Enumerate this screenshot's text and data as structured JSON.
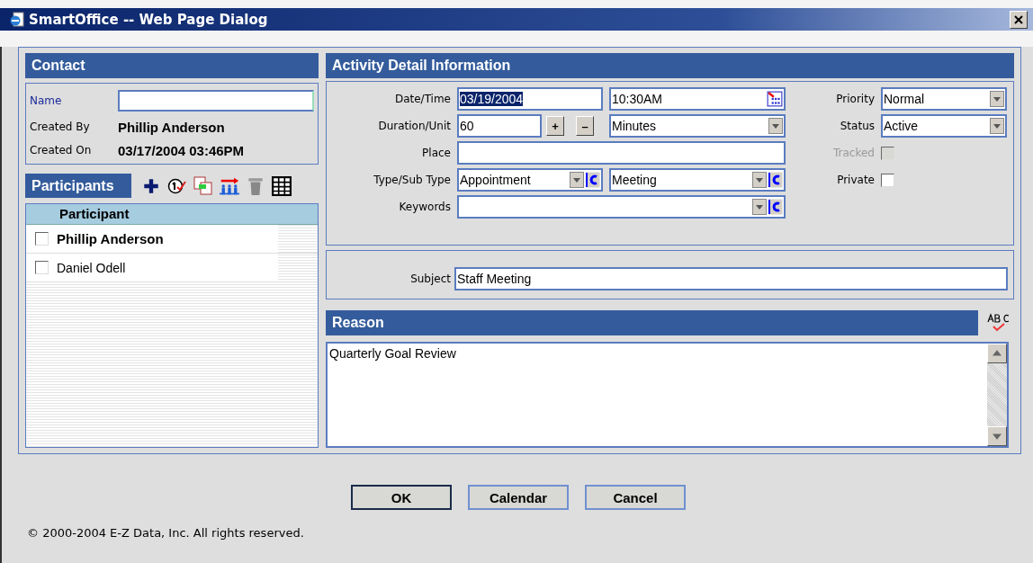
{
  "window": {
    "title": "SmartOffice -- Web Page Dialog"
  },
  "contact": {
    "header": "Contact",
    "fields": [
      {
        "label": "Name",
        "kind": "input",
        "link": true
      },
      {
        "label": "Created By",
        "kind": "value",
        "value": "Phillip Anderson",
        "link": false
      },
      {
        "label": "Created On",
        "kind": "value",
        "value": "03/17/2004 03:46PM",
        "link": false
      }
    ]
  },
  "participants": {
    "header": "Participants",
    "column": "Participant",
    "rows": [
      {
        "name": "Phillip Anderson",
        "checked": false,
        "primary": true
      },
      {
        "name": "Daniel Odell",
        "checked": false,
        "primary": false
      }
    ]
  },
  "activity": {
    "header": "Activity Detail Information",
    "rows": [
      {
        "label": "Date/Time",
        "controls": [
          {
            "kind": "text",
            "value": "03/19/2004",
            "highlighted": true
          },
          {
            "kind": "time",
            "value": "10:30AM"
          }
        ]
      },
      {
        "label": "Duration/Unit",
        "controls": [
          {
            "kind": "spinner",
            "value": "60",
            "buttons": [
              "+",
              "–"
            ]
          },
          {
            "kind": "select",
            "value": "Minutes"
          }
        ]
      },
      {
        "label": "Place",
        "controls": [
          {
            "kind": "wide"
          }
        ]
      },
      {
        "label": "Type/Sub Type",
        "controls": [
          {
            "kind": "combo",
            "value": "Appointment"
          },
          {
            "kind": "combo",
            "value": "Meeting"
          }
        ]
      },
      {
        "label": "Keywords",
        "controls": [
          {
            "kind": "wide-combo"
          }
        ]
      }
    ],
    "side": [
      {
        "label": "Priority",
        "kind": "select",
        "value": "Normal"
      },
      {
        "label": "Status",
        "kind": "select",
        "value": "Active"
      },
      {
        "label": "Tracked",
        "kind": "checkbox",
        "checked": false,
        "disabled": true
      },
      {
        "label": "Private",
        "kind": "checkbox",
        "checked": false,
        "disabled": false
      }
    ],
    "subject": {
      "label": "Subject",
      "value": "Staff Meeting"
    }
  },
  "reason": {
    "header": "Reason",
    "value": "Quarterly Goal Review"
  },
  "buttons": [
    {
      "label": "OK",
      "default": true
    },
    {
      "label": "Calendar",
      "default": false
    },
    {
      "label": "Cancel",
      "default": false
    }
  ],
  "copyright": "© 2000-2004 E-Z Data, Inc. All rights reserved."
}
